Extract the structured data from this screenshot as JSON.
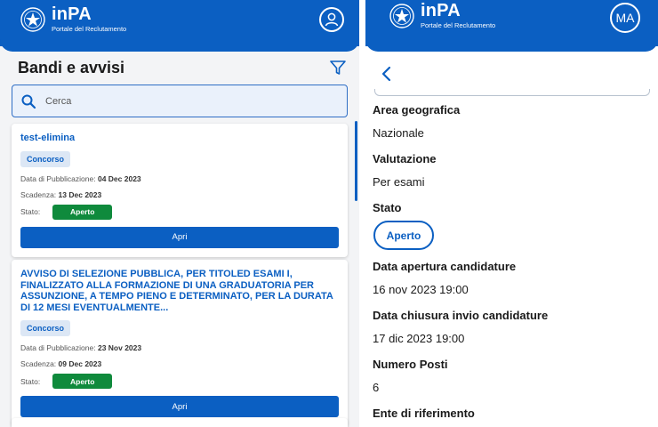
{
  "left": {
    "header": {
      "brand": "inPA",
      "subtitle": "Portale del Reclutamento"
    },
    "page_title": "Bandi e avvisi",
    "search": {
      "placeholder": "Cerca"
    },
    "cards": [
      {
        "title": "test-elimina",
        "badge": "Concorso",
        "pub_label": "Data di Pubblicazione:",
        "pub_date": "04 Dec 2023",
        "deadline_label": "Scadenza:",
        "deadline": "13 Dec 2023",
        "status_label": "Stato:",
        "status": "Aperto",
        "button": "Apri"
      },
      {
        "title": "AVVISO DI SELEZIONE PUBBLICA, PER TITOLED ESAMI I, FINALIZZATO ALLA FORMAZIONE DI UNA GRADUATORIA PER ASSUNZIONE, A TEMPO PIENO E DETERMINATO, PER LA DURATA DI 12 MESI EVENTUALMENTE...",
        "badge": "Concorso",
        "pub_label": "Data di Pubblicazione:",
        "pub_date": "23 Nov 2023",
        "deadline_label": "Scadenza:",
        "deadline": "09 Dec 2023",
        "status_label": "Stato:",
        "status": "Aperto",
        "button": "Apri"
      }
    ]
  },
  "right": {
    "header": {
      "brand": "inPA",
      "subtitle": "Portale del Reclutamento",
      "user_initials": "MA"
    },
    "fields": [
      {
        "label": "Area geografica",
        "value": "Nazionale"
      },
      {
        "label": "Valutazione",
        "value": "Per esami"
      },
      {
        "label": "Stato",
        "value": "Aperto"
      },
      {
        "label": "Data apertura candidature",
        "value": "16 nov 2023 19:00"
      },
      {
        "label": "Data chiusura invio candidature",
        "value": "17 dic 2023 19:00"
      },
      {
        "label": "Numero Posti",
        "value": "6"
      },
      {
        "label": "Ente di riferimento",
        "value": ""
      }
    ]
  },
  "colors": {
    "primary": "#0b5fc2",
    "status_green": "#0f8a3c",
    "badge_bg": "#dce7f5"
  }
}
